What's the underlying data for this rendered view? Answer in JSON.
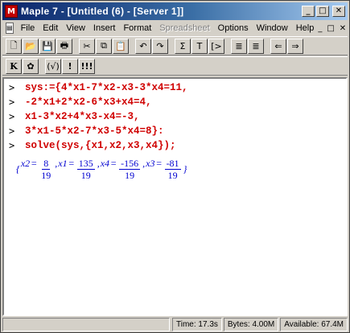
{
  "window": {
    "app_icon": "M",
    "title": "Maple 7 - [Untitled (6) - [Server 1]]",
    "minimize": "_",
    "maximize": "□",
    "close": "✕"
  },
  "menu": {
    "items": [
      "File",
      "Edit",
      "View",
      "Insert",
      "Format",
      "Spreadsheet",
      "Options",
      "Window",
      "Help"
    ],
    "disabled": [
      "Spreadsheet"
    ],
    "controls": [
      "_",
      "□",
      "✕"
    ]
  },
  "toolbar1": [
    {
      "name": "new-icon",
      "glyph": "🗋"
    },
    {
      "name": "open-icon",
      "glyph": "📂"
    },
    {
      "name": "save-icon",
      "glyph": "💾"
    },
    {
      "name": "print-icon",
      "glyph": "🖶"
    },
    {
      "name": "cut-icon",
      "glyph": "✂"
    },
    {
      "name": "copy-icon",
      "glyph": "⧉"
    },
    {
      "name": "paste-icon",
      "glyph": "📋"
    },
    {
      "name": "undo-icon",
      "glyph": "↶"
    },
    {
      "name": "redo-icon",
      "glyph": "↷"
    },
    {
      "name": "math-input-icon",
      "glyph": "Σ"
    },
    {
      "name": "text-input-icon",
      "glyph": "T"
    },
    {
      "name": "exec-group-icon",
      "glyph": "[>"
    },
    {
      "name": "outdent-icon",
      "glyph": "≣"
    },
    {
      "name": "indent-icon",
      "glyph": "≣"
    },
    {
      "name": "back-icon",
      "glyph": "⇐"
    },
    {
      "name": "forward-icon",
      "glyph": "⇒"
    }
  ],
  "toolbar2": [
    {
      "name": "context-k-icon",
      "glyph": "K"
    },
    {
      "name": "maple-leaf-icon",
      "glyph": "✿"
    },
    {
      "name": "text-mode-icon",
      "glyph": "(√)"
    },
    {
      "name": "execute-icon",
      "glyph": "!"
    },
    {
      "name": "execute-all-icon",
      "glyph": "!!!"
    }
  ],
  "worksheet": {
    "prompt": ">",
    "lines": [
      "sys:={4*x1-7*x2-x3-3*x4=11,",
      "-2*x1+2*x2-6*x3+x4=4,",
      "x1-3*x2+4*x3-x4=-3,",
      "3*x1-5*x2-7*x3-5*x4=8}:",
      "solve(sys,{x1,x2,x3,x4});"
    ],
    "output": {
      "open": "{",
      "terms": [
        {
          "var": "x2",
          "num": "8",
          "den": "19"
        },
        {
          "var": "x1",
          "num": "135",
          "den": "19"
        },
        {
          "var": "x4",
          "num": "-156",
          "den": "19"
        },
        {
          "var": "x3",
          "num": "-81",
          "den": "19"
        }
      ],
      "close": "}"
    }
  },
  "status": {
    "time": "Time: 17.3s",
    "bytes": "Bytes: 4.00M",
    "available": "Available: 67.4M"
  },
  "colors": {
    "input": "#d00000",
    "output": "#0000d0",
    "titlebar_start": "#0a246a",
    "titlebar_end": "#a6caf0"
  }
}
